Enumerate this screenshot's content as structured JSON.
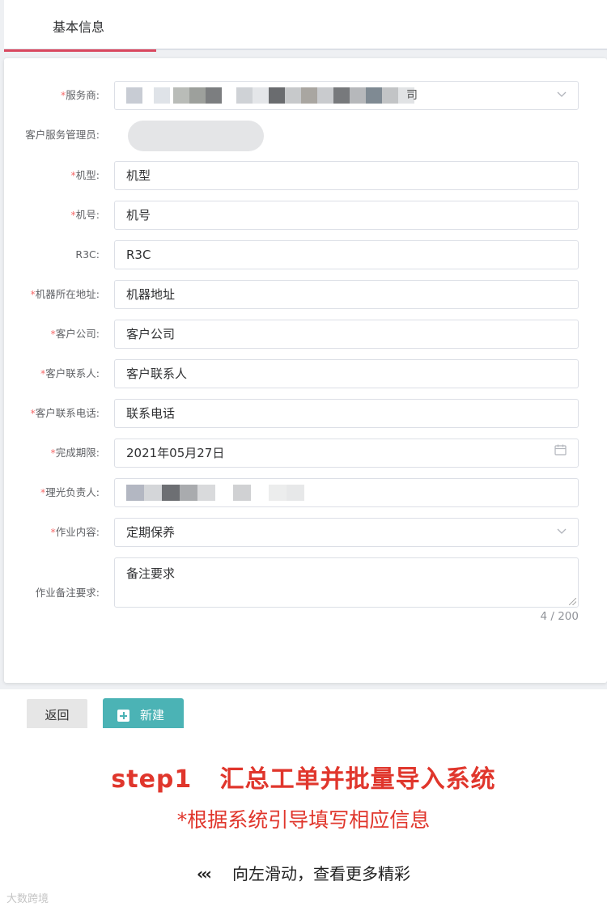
{
  "tab": {
    "label": "基本信息"
  },
  "form": {
    "service_provider": {
      "label": "服务商:",
      "value_tail": "司"
    },
    "customer_manager": {
      "label": "客户服务管理员:"
    },
    "model": {
      "label": "机型:",
      "value": "机型"
    },
    "serial": {
      "label": "机号:",
      "value": "机号"
    },
    "r3c": {
      "label": "R3C:",
      "value": "R3C"
    },
    "address": {
      "label": "机器所在地址:",
      "value": "机器地址"
    },
    "company": {
      "label": "客户公司:",
      "value": "客户公司"
    },
    "contact": {
      "label": "客户联系人:",
      "value": "客户联系人"
    },
    "phone": {
      "label": "客户联系电话:",
      "value": "联系电话"
    },
    "deadline": {
      "label": "完成期限:",
      "value": "2021年05月27日"
    },
    "owner": {
      "label": "理光负责人:"
    },
    "work_content": {
      "label": "作业内容:",
      "value": "定期保养"
    },
    "remarks": {
      "label": "作业备注要求:",
      "value": "备注要求",
      "counter": "4 / 200"
    }
  },
  "required_mark": "*",
  "buttons": {
    "back": "返回",
    "new": "新建"
  },
  "caption": {
    "title": "step1   汇总工单并批量导入系统",
    "subtitle": "*根据系统引导填写相应信息",
    "swipe_chevrons": "‹‹‹",
    "swipe_text": "向左滑动，查看更多精彩",
    "watermark": "大数跨境"
  },
  "colors": {
    "accent": "#e0362c",
    "tab_ink": "#d9475e",
    "primary_button": "#4bb3b5",
    "required": "#f56c6c"
  },
  "icons": {
    "select": "chevron-down-icon",
    "date": "calendar-icon",
    "new": "plus-square-icon"
  }
}
